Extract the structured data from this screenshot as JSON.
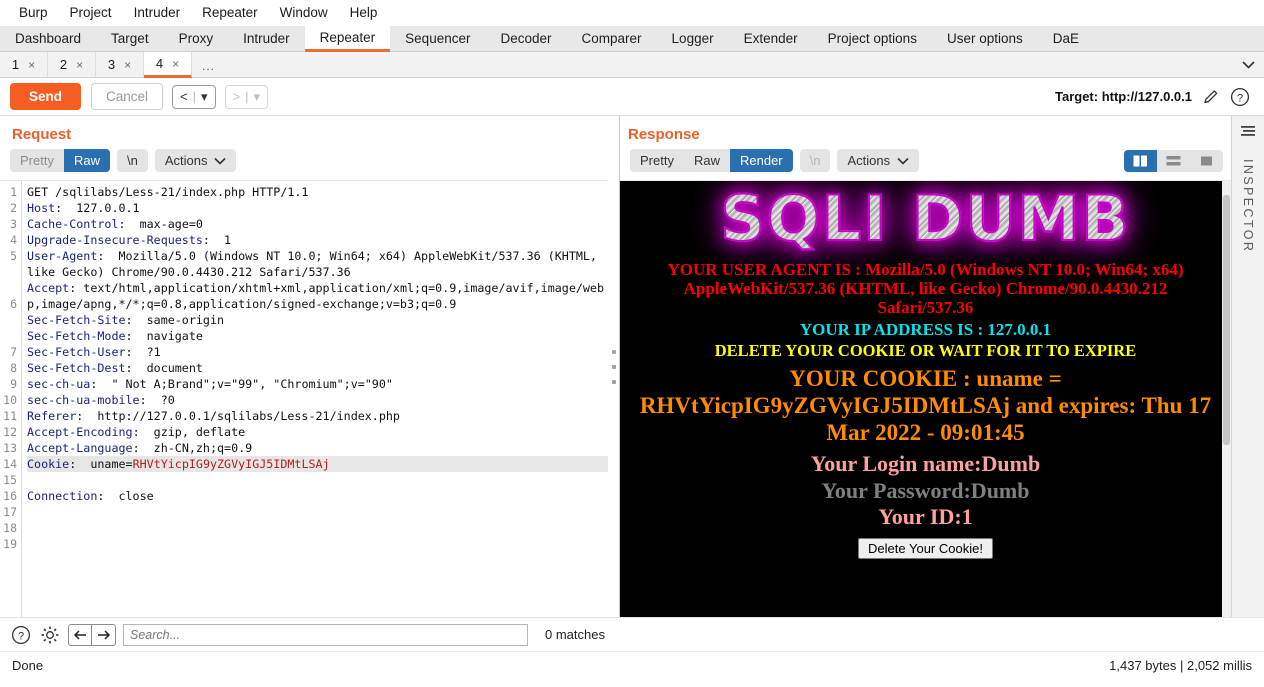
{
  "menu": {
    "items": [
      "Burp",
      "Project",
      "Intruder",
      "Repeater",
      "Window",
      "Help"
    ]
  },
  "main_tabs": {
    "selected": "Repeater",
    "items": [
      "Dashboard",
      "Target",
      "Proxy",
      "Intruder",
      "Repeater",
      "Sequencer",
      "Decoder",
      "Comparer",
      "Logger",
      "Extender",
      "Project options",
      "User options",
      "DaE"
    ]
  },
  "repeater_tabs": {
    "selected": "4",
    "items": [
      {
        "label": "1",
        "close": "×"
      },
      {
        "label": "2",
        "close": "×"
      },
      {
        "label": "3",
        "close": "×"
      },
      {
        "label": "4",
        "close": "×"
      }
    ],
    "overflow": "...",
    "chevron_icon": "chevron-down-icon"
  },
  "actionbar": {
    "send_label": "Send",
    "cancel_label": "Cancel",
    "back_label": "<",
    "back_caret": "▾",
    "forward_label": ">",
    "forward_caret": "▾",
    "target_label": "Target: http://127.0.0.1",
    "edit_icon": "pencil-icon",
    "help_icon": "help-circle-icon"
  },
  "request": {
    "title": "Request",
    "modes": [
      "Pretty",
      "Raw"
    ],
    "selected_mode": "Raw",
    "newline_label": "\\n",
    "actions_label": "Actions",
    "actions_caret": "⌵",
    "line_numbers": [
      "1",
      "2",
      "3",
      "4",
      "5",
      "6",
      "7",
      "8",
      "9",
      "10",
      "11",
      "12",
      "13",
      "14",
      "15",
      "16",
      "17",
      "18",
      "19"
    ],
    "lines": [
      {
        "n": 1,
        "key": "",
        "text": "GET /sqlilabs/Less-21/index.php HTTP/1.1"
      },
      {
        "n": 2,
        "key": "Host",
        "text": ":  127.0.0.1"
      },
      {
        "n": 3,
        "key": "Cache-Control",
        "text": ":  max-age=0"
      },
      {
        "n": 4,
        "key": "Upgrade-Insecure-Requests",
        "text": ":  1"
      },
      {
        "n": 5,
        "key": "User-Agent",
        "text": ":  Mozilla/5.0 (Windows NT 10.0; Win64; x64) AppleWebKit/537.36 (KHTML, like Gecko) Chrome/90.0.4430.212 Safari/537.36"
      },
      {
        "n": 6,
        "key": "Accept",
        "text": ": text/html,application/xhtml+xml,application/xml;q=0.9,image/avif,image/webp,image/apng,*/*;q=0.8,application/signed-exchange;v=b3;q=0.9"
      },
      {
        "n": 7,
        "key": "Sec-Fetch-Site",
        "text": ":  same-origin"
      },
      {
        "n": 8,
        "key": "Sec-Fetch-Mode",
        "text": ":  navigate"
      },
      {
        "n": 9,
        "key": "Sec-Fetch-User",
        "text": ":  ?1"
      },
      {
        "n": 10,
        "key": "Sec-Fetch-Dest",
        "text": ":  document"
      },
      {
        "n": 11,
        "key": "sec-ch-ua",
        "text": ":  \" Not A;Brand\";v=\"99\", \"Chromium\";v=\"90\""
      },
      {
        "n": 12,
        "key": "sec-ch-ua-mobile",
        "text": ":  ?0"
      },
      {
        "n": 13,
        "key": "Referer",
        "text": ":  http://127.0.0.1/sqlilabs/Less-21/index.php"
      },
      {
        "n": 14,
        "key": "Accept-Encoding",
        "text": ":  gzip, deflate"
      },
      {
        "n": 15,
        "key": "Accept-Language",
        "text": ":  zh-CN,zh;q=0.9"
      },
      {
        "n": 16,
        "key": "Cookie",
        "text": ":  uname=",
        "cookie_value": "RHVtYicpIG9yZGVyIGJ5IDMtLSAj",
        "highlighted": true
      },
      {
        "n": 17,
        "key": "Connection",
        "text": ":  close"
      },
      {
        "n": 18,
        "key": "",
        "text": ""
      },
      {
        "n": 19,
        "key": "",
        "text": ""
      }
    ]
  },
  "response": {
    "title": "Response",
    "modes": [
      "Pretty",
      "Raw",
      "Render"
    ],
    "selected_mode": "Render",
    "newline_label": "\\n",
    "actions_label": "Actions",
    "actions_caret": "⌵",
    "layout_toggles": [
      {
        "name": "split-vertical-icon",
        "selected": true
      },
      {
        "name": "split-horizontal-icon",
        "selected": false
      },
      {
        "name": "single-pane-icon",
        "selected": false
      }
    ],
    "rendered": {
      "banner": "SQLI DUMB",
      "user_agent_line": "YOUR USER AGENT IS : Mozilla/5.0 (Windows NT 10.0; Win64; x64) AppleWebKit/537.36 (KHTML, like Gecko) Chrome/90.0.4430.212 Safari/537.36",
      "ip_line": "YOUR IP ADDRESS IS : 127.0.0.1",
      "warning_line": "DELETE YOUR COOKIE OR WAIT FOR IT TO EXPIRE",
      "cookie_line": "YOUR COOKIE : uname = RHVtYicpIG9yZGVyIGJ5IDMtLSAj and expires: Thu 17 Mar 2022 - 09:01:45",
      "login_line": "Your Login name:Dumb",
      "password_line": "Your Password:Dumb",
      "id_line": "Your ID:1",
      "delete_button": "Delete Your Cookie!"
    }
  },
  "inspector": {
    "label": "INSPECTOR",
    "toggle_icon": "panel-collapse-icon"
  },
  "search": {
    "help_icon": "help-circle-icon",
    "settings_icon": "gear-icon",
    "prev_icon": "arrow-left-icon",
    "next_icon": "arrow-right-icon",
    "placeholder": "Search...",
    "value": "",
    "matches": "0 matches"
  },
  "statusbar": {
    "left": "Done",
    "right": "1,437 bytes | 2,052 millis"
  },
  "colors": {
    "accent_orange": "#ec6c32",
    "send_orange": "#f65d23",
    "select_blue": "#2a6fb0",
    "header_key_blue": "#1a237e",
    "cookie_red": "#b71c1c"
  }
}
